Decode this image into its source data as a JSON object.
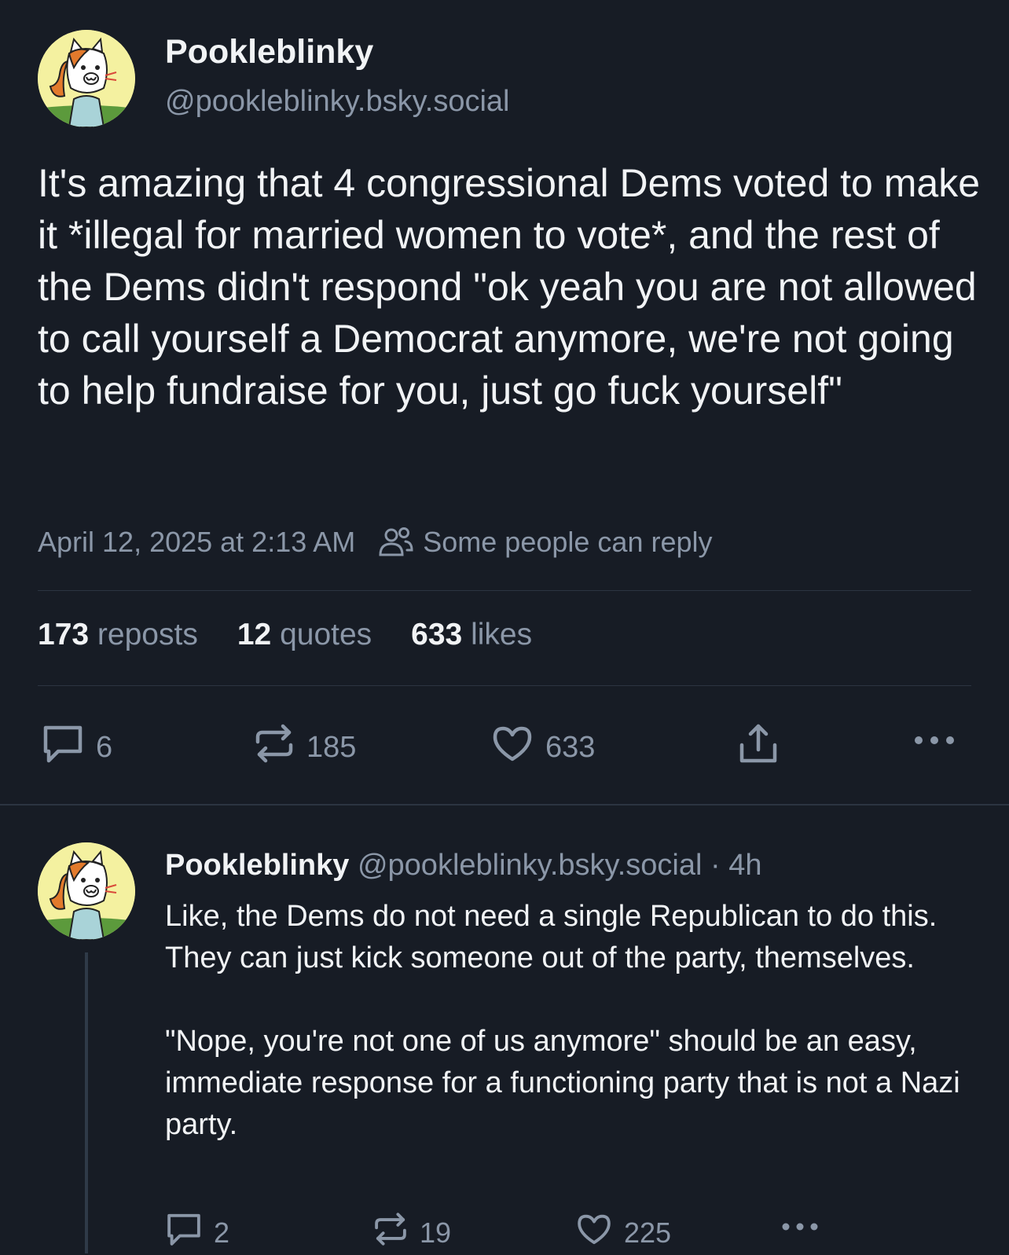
{
  "post": {
    "author": {
      "display_name": "Pookleblinky",
      "handle": "@pookleblinky.bsky.social",
      "avatar_icon": "cartoon-cat-avatar"
    },
    "text": "It's amazing that 4 congressional Dems voted to make it *illegal for married women to vote*, and the rest of the Dems didn't respond \"ok yeah you are not allowed to call yourself a Democrat anymore, we're not going to help fundraise for you, just go fuck yourself\"",
    "timestamp": "April 12, 2025 at 2:13 AM",
    "reply_setting": "Some people can reply",
    "stats": {
      "reposts_count": "173",
      "reposts_label": "reposts",
      "quotes_count": "12",
      "quotes_label": "quotes",
      "likes_count": "633",
      "likes_label": "likes"
    },
    "actions": {
      "reply_count": "6",
      "repost_count": "185",
      "like_count": "633"
    }
  },
  "reply": {
    "author": {
      "display_name": "Pookleblinky",
      "handle": "@pookleblinky.bsky.social",
      "separator": "·",
      "time_ago": "4h"
    },
    "text": "Like, the Dems do not need a single Republican to do this. They can just kick someone out of the party, themselves.\n\n\"Nope, you're not one of us anymore\" should be an easy, immediate response for a functioning party that is not a Nazi party.",
    "actions": {
      "reply_count": "2",
      "repost_count": "19",
      "like_count": "225"
    }
  },
  "colors": {
    "background": "#171c25",
    "text_primary": "#f1f3f5",
    "text_secondary": "#8b97a8",
    "divider": "#2c3441"
  }
}
